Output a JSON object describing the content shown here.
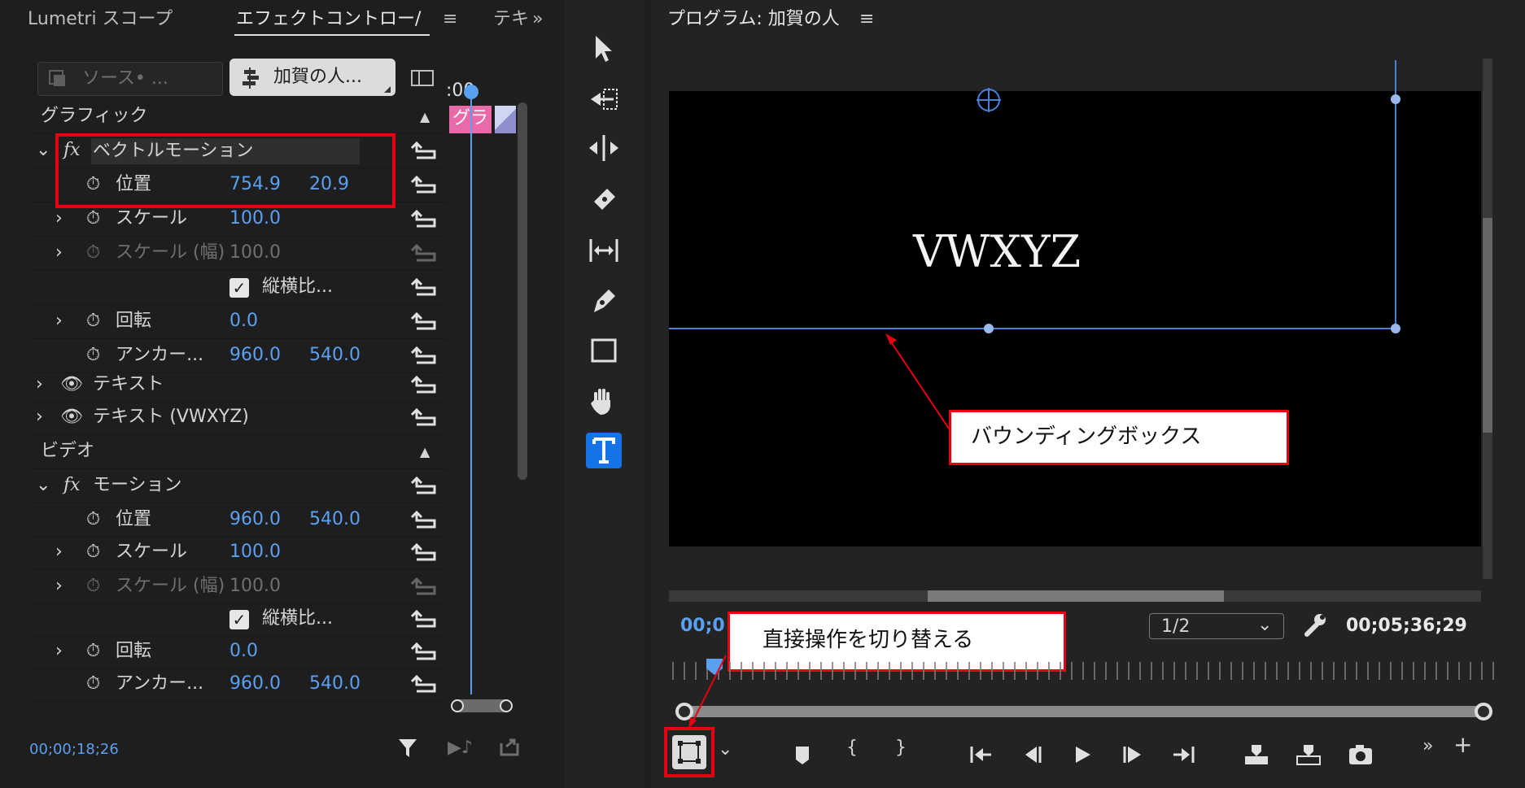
{
  "left_panel": {
    "tabs": {
      "lumetri": "Lumetri スコープ",
      "effect_controls": "エフェクトコントロー/",
      "text": "テキ"
    },
    "source_dropdown": "ソース• ...",
    "clip_dropdown": "加賀の人...",
    "timeline_ruler": ":00",
    "timeline_clip": "グラ",
    "sections": {
      "graphics": "グラフィック",
      "video": "ビデオ"
    },
    "graphics_effects": {
      "vector_motion": "ベクトルモーション",
      "position": {
        "label": "位置",
        "x": "754.9",
        "y": "20.9"
      },
      "scale": {
        "label": "スケール",
        "value": "100.0"
      },
      "scale_width": {
        "label": "スケール (幅)",
        "value": "100.0"
      },
      "uniform_scale": "縦横比...",
      "rotation": {
        "label": "回転",
        "value": "0.0"
      },
      "anchor": {
        "label": "アンカー...",
        "x": "960.0",
        "y": "540.0"
      },
      "text1": "テキスト",
      "text2": "テキスト (VWXYZ)"
    },
    "video_effects": {
      "motion": "モーション",
      "position": {
        "label": "位置",
        "x": "960.0",
        "y": "540.0"
      },
      "scale": {
        "label": "スケール",
        "value": "100.0"
      },
      "scale_width": {
        "label": "スケール (幅)",
        "value": "100.0"
      },
      "uniform_scale": "縦横比...",
      "rotation": {
        "label": "回転",
        "value": "0.0"
      },
      "anchor": {
        "label": "アンカー...",
        "x": "960.0",
        "y": "540.0"
      }
    },
    "timecode": "00;00;18;26"
  },
  "tools": [
    "selection-tool-icon",
    "track-select-icon",
    "ripple-edit-icon",
    "razor-icon",
    "slip-icon",
    "pen-icon",
    "rectangle-icon",
    "hand-icon",
    "type-icon"
  ],
  "program_panel": {
    "title": "プログラム: 加賀の人",
    "video_text": "VWXYZ",
    "current_time": "00;0",
    "resolution": "1/2",
    "duration": "00;05;36;29"
  },
  "annotations": {
    "bounding_box": "バウンディングボックス",
    "toggle_direct": "直接操作を切り替える"
  },
  "colors": {
    "accent": "#5aa0f0",
    "highlight": "#e60012",
    "clip_pink": "#e86aa8",
    "panel": "#232323"
  }
}
